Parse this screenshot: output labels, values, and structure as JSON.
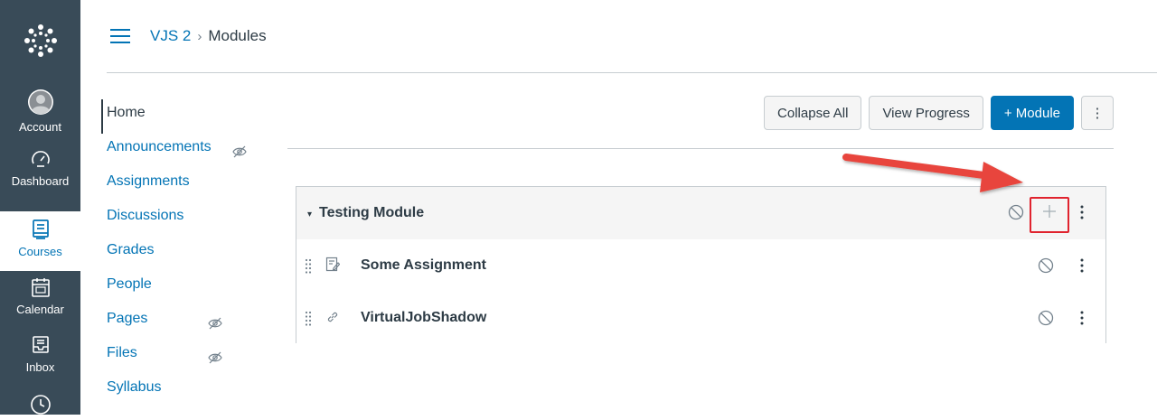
{
  "global_nav": {
    "logo_icon": "canvas-logo-icon",
    "items": [
      {
        "label": "Account",
        "icon": "user-avatar-icon"
      },
      {
        "label": "Dashboard",
        "icon": "speedometer-icon"
      },
      {
        "label": "Courses",
        "icon": "book-icon"
      },
      {
        "label": "Calendar",
        "icon": "calendar-icon"
      },
      {
        "label": "Inbox",
        "icon": "inbox-icon"
      },
      {
        "label": "",
        "icon": "clock-icon"
      }
    ]
  },
  "header": {
    "course": "VJS 2",
    "separator": "›",
    "current": "Modules"
  },
  "course_nav": {
    "items": [
      {
        "label": "Home",
        "active": true
      },
      {
        "label": "Announcements",
        "hidden": true
      },
      {
        "label": "Assignments"
      },
      {
        "label": "Discussions"
      },
      {
        "label": "Grades"
      },
      {
        "label": "People"
      },
      {
        "label": "Pages",
        "hidden": true
      },
      {
        "label": "Files",
        "hidden": true
      },
      {
        "label": "Syllabus"
      }
    ]
  },
  "toolbar": {
    "collapse_all": "Collapse All",
    "view_progress": "View Progress",
    "add_module": "+ Module",
    "more": "⋮"
  },
  "module": {
    "title": "Testing Module",
    "caret": "▾",
    "items": [
      {
        "title": "Some Assignment",
        "type_icon": "assignment-icon"
      },
      {
        "title": "VirtualJobShadow",
        "type_icon": "link-icon"
      }
    ]
  },
  "colors": {
    "nav_bg": "#394b58",
    "link": "#0374b5",
    "primary_button": "#0374b5",
    "highlight": "#e0232e",
    "arrow": "#e8453c"
  }
}
